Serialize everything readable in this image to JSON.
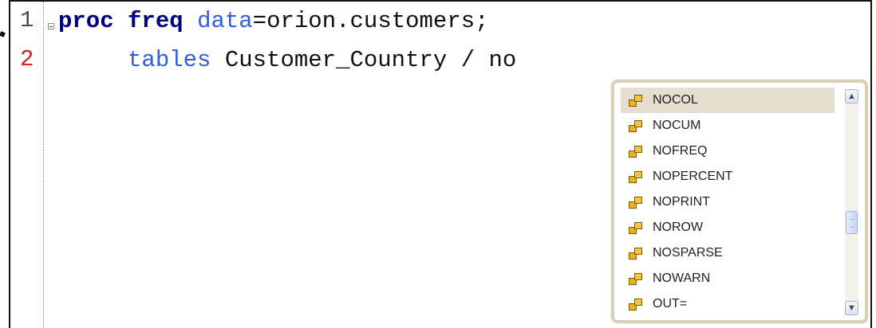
{
  "editor": {
    "line_numbers": [
      "1",
      "2"
    ],
    "code": {
      "line1": {
        "keyword_proc": "proc",
        "keyword_freq": "freq",
        "option_data": "data",
        "equals": "=orion.customers;"
      },
      "line2": {
        "tables_keyword": "tables",
        "rest": "Customer_Country / no"
      }
    }
  },
  "autocomplete": {
    "items": [
      {
        "label": "NOCOL",
        "icon": "option-icon",
        "selected": true
      },
      {
        "label": "NOCUM",
        "icon": "option-icon"
      },
      {
        "label": "NOFREQ",
        "icon": "option-icon"
      },
      {
        "label": "NOPERCENT",
        "icon": "option-icon"
      },
      {
        "label": "NOPRINT",
        "icon": "option-icon"
      },
      {
        "label": "NOROW",
        "icon": "option-icon"
      },
      {
        "label": "NOSPARSE",
        "icon": "option-icon"
      },
      {
        "label": "NOWARN",
        "icon": "option-icon"
      },
      {
        "label": "OUT=",
        "icon": "option-icon"
      }
    ],
    "scroll_up_icon": "chevron-up-icon",
    "scroll_down_icon": "chevron-down-icon"
  },
  "colors": {
    "keyword": "#000080",
    "option": "#2f5fd9",
    "line_number_current": "#e01b1b",
    "selection": "#e5dfcf"
  }
}
